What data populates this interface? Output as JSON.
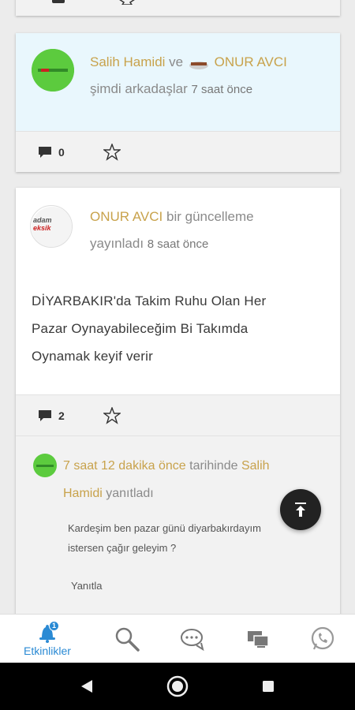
{
  "card1": {
    "user1": "Salih Hamidi",
    "joiner": "ve",
    "user2": "ONUR AVCI",
    "action": "şimdi arkadaşlar",
    "time": "7 saat önce",
    "comment_count": "0",
    "avatar_icon": "green-logo-avatar",
    "user2_icon": "boat-avatar-icon"
  },
  "card2": {
    "user": "ONUR AVCI",
    "action_line1": "bir güncelleme",
    "action_line2": "yayınladı",
    "time": "8 saat önce",
    "avatar_text_top": "adam",
    "avatar_text_bottom": "eksik",
    "body_line1": "DİYARBAKIR'da Takim Ruhu Olan Her",
    "body_line2": "Pazar Oynayabileceğim Bi Takımda",
    "body_line3": "Oynamak keyif verir",
    "comment_count": "2"
  },
  "reply": {
    "time_link": "7 saat 12 dakika önce",
    "mid": "tarihinde",
    "user_part1": "Salih",
    "user_part2": "Hamidi",
    "action": "yanıtladı",
    "text_line1": "Kardeşim ben pazar günü diyarbakırdayım",
    "text_line2": "istersen çağır geleyim ?",
    "reply_label": "Yanıtla"
  },
  "tabs": {
    "activity_label": "Etkinlikler",
    "badge": "1"
  },
  "colors": {
    "accent": "#2a8ad4",
    "gold": "#c8a24b",
    "highlight_bg": "#e9f7fd"
  }
}
